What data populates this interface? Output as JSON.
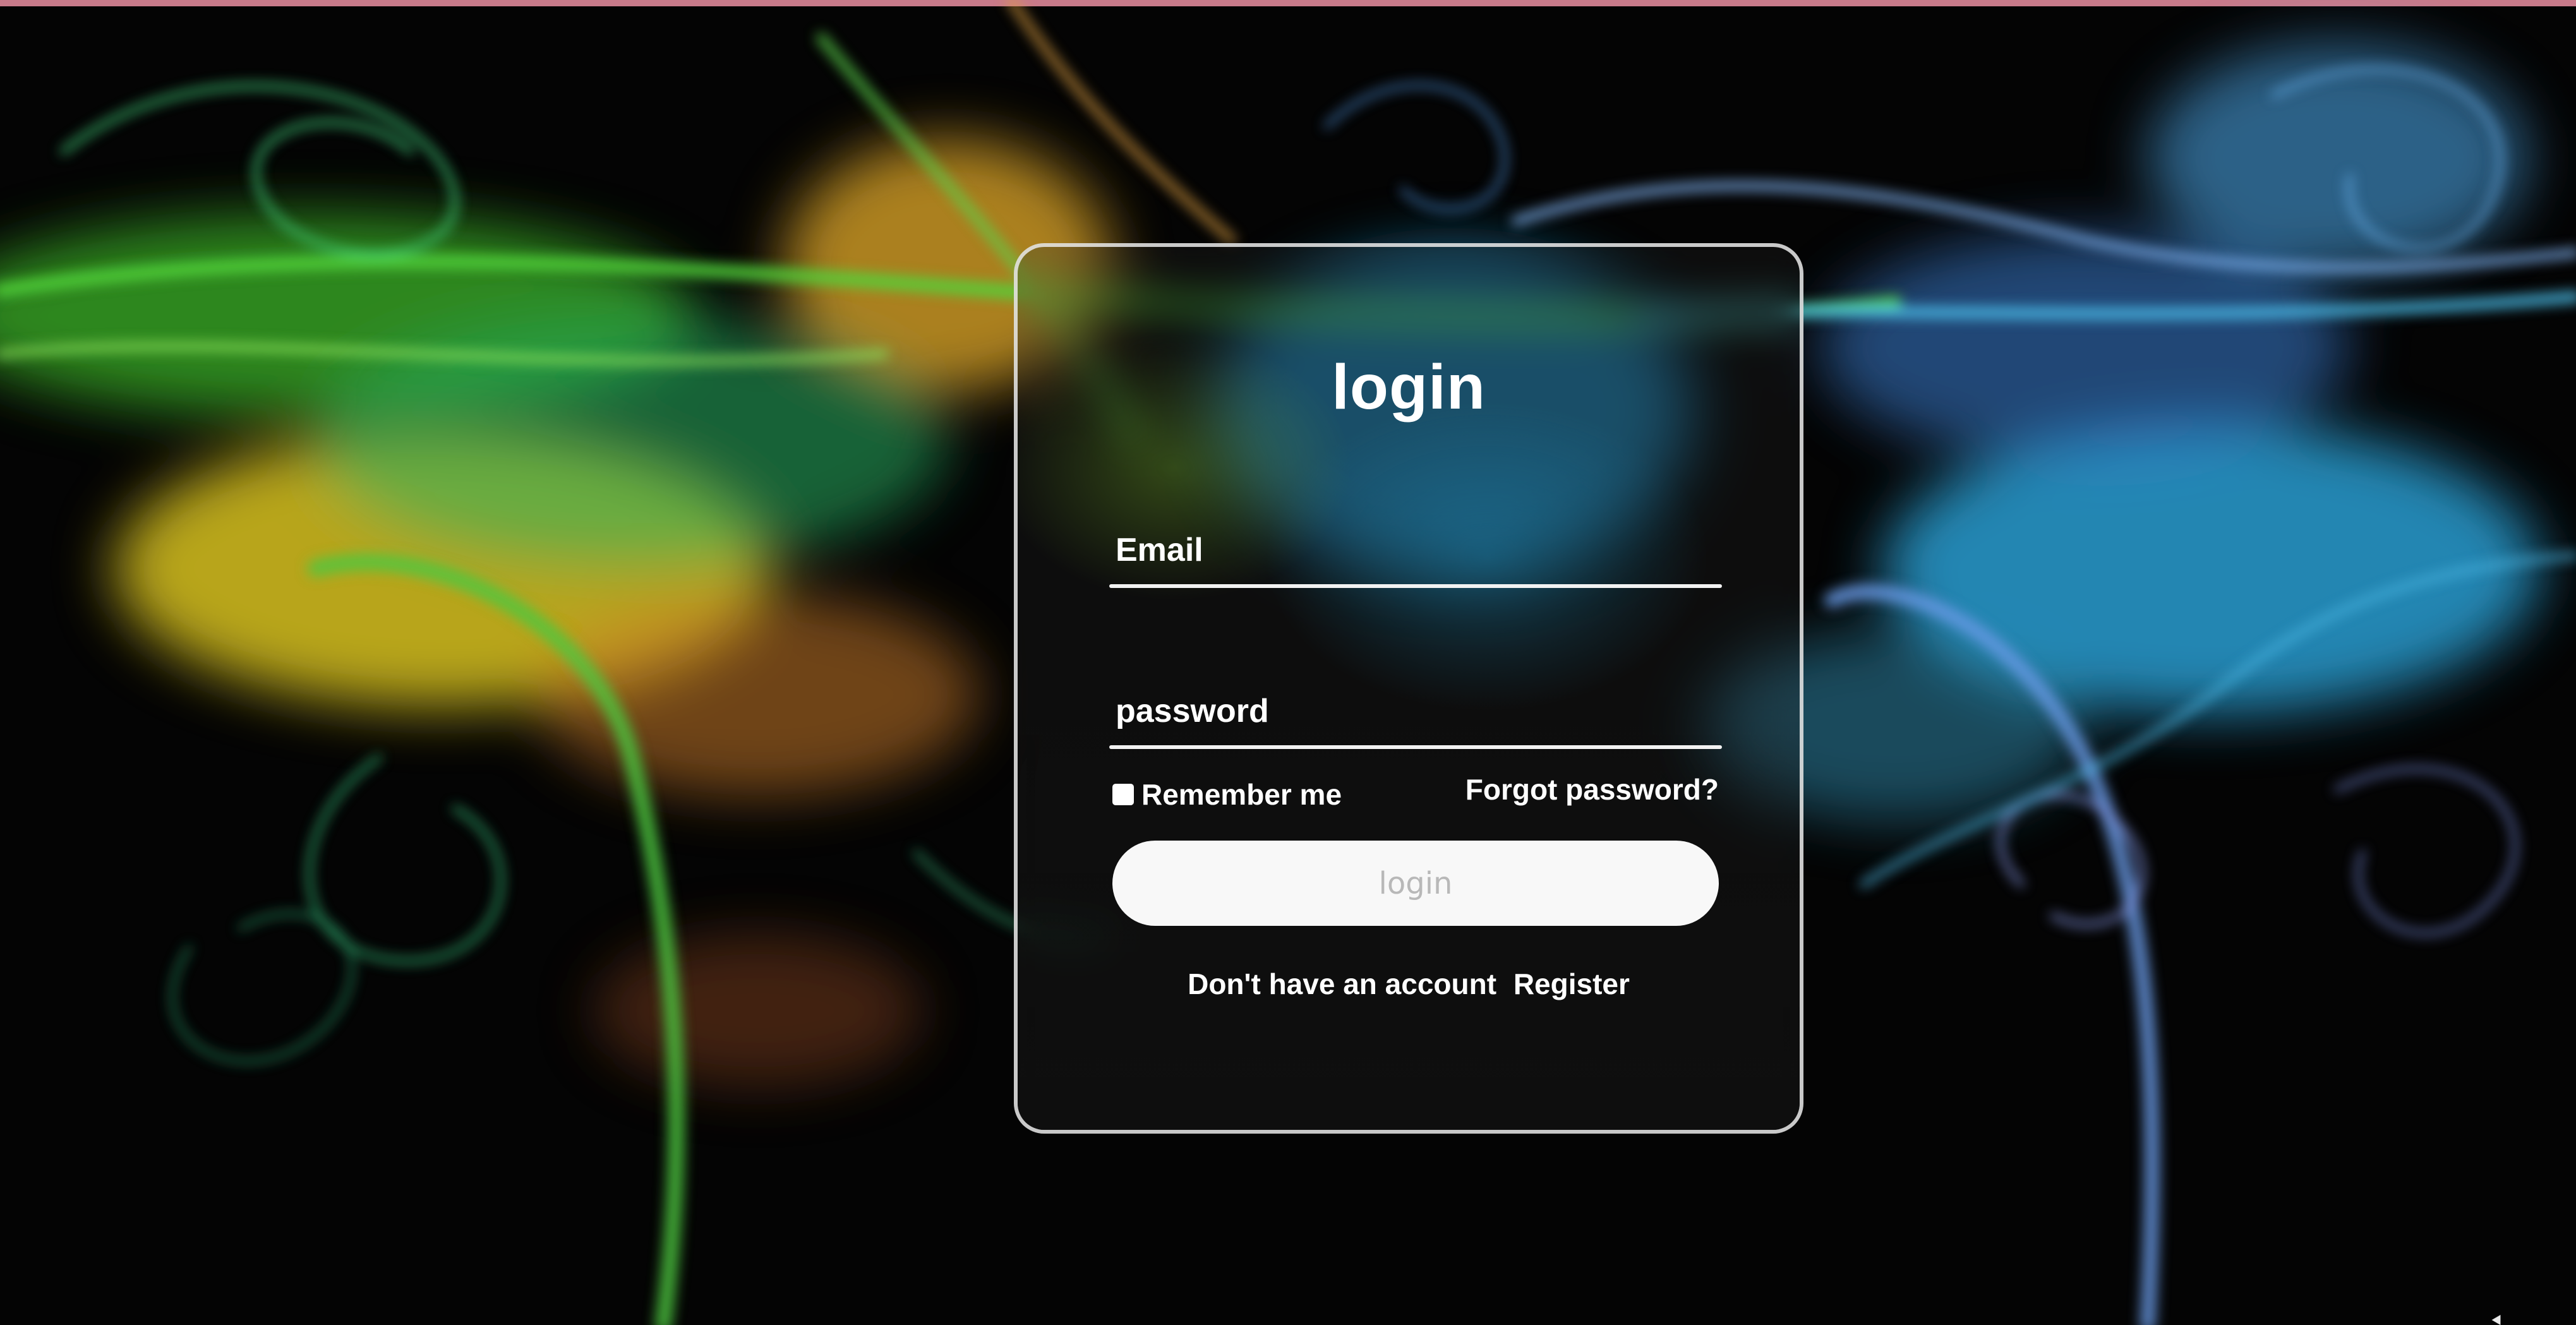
{
  "login_card": {
    "title": "login",
    "email": {
      "placeholder": "Email",
      "value": ""
    },
    "password": {
      "placeholder": "password",
      "value": ""
    },
    "remember_label": "Remember me",
    "forgot_link": "Forgot password?",
    "submit_label": "login",
    "register_prompt": "Don't have an account",
    "register_link": "Register"
  },
  "colors": {
    "card_border": "#ebebeb",
    "button_bg": "#f8f8f8",
    "button_text": "#b8b8b8",
    "text": "#ffffff"
  }
}
